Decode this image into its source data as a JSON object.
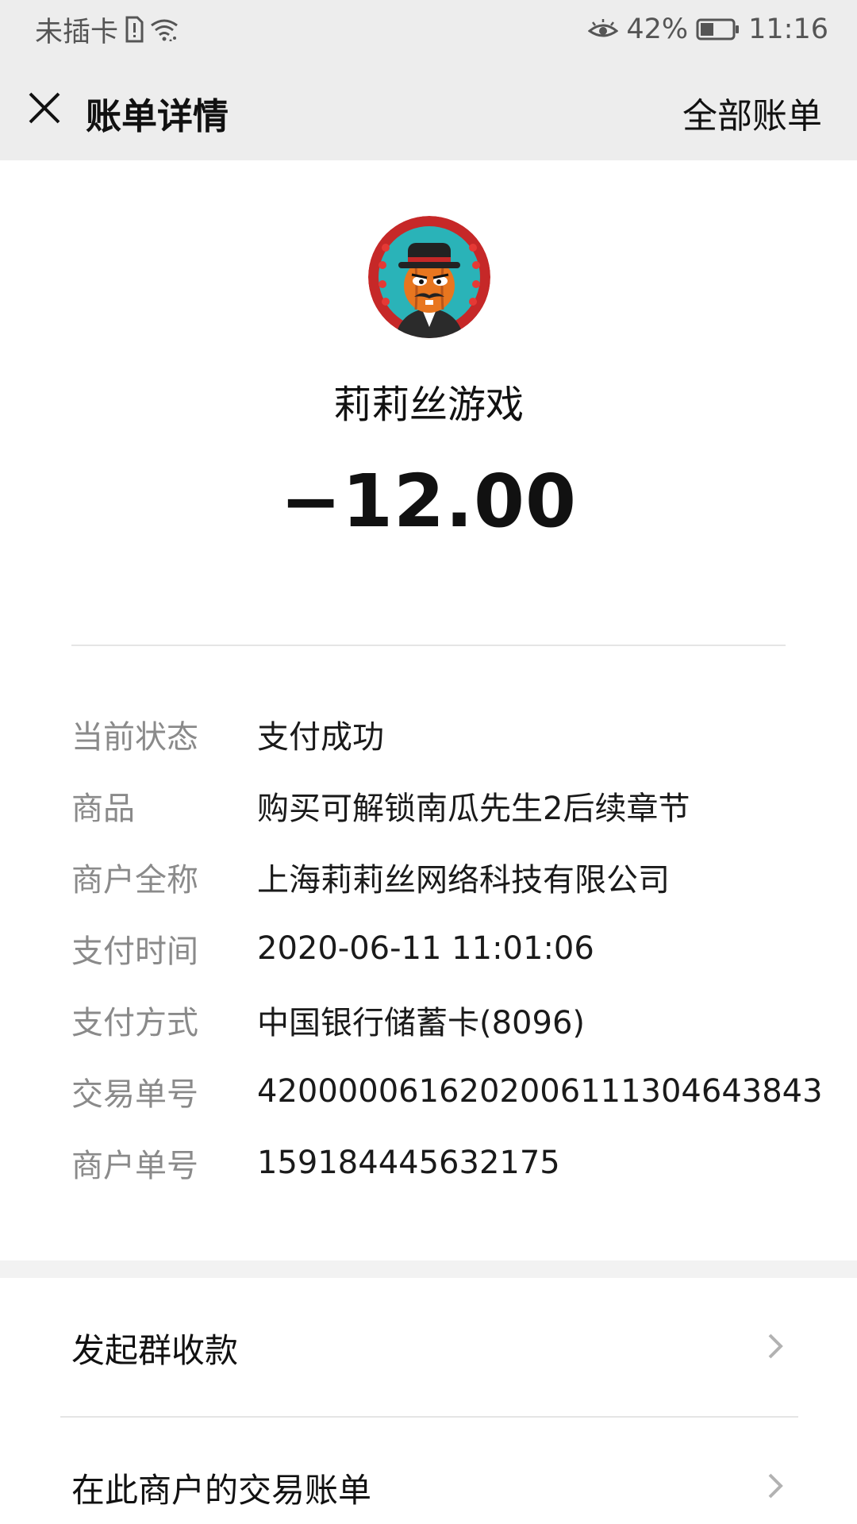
{
  "status_bar": {
    "carrier": "未插卡",
    "battery_percent": "42%",
    "time": "11:16",
    "battery_level": 0.42
  },
  "nav": {
    "title": "账单详情",
    "action": "全部账单",
    "close_icon": "close-icon"
  },
  "merchant": {
    "name": "莉莉丝游戏",
    "amount": "−12.00"
  },
  "details": [
    {
      "label": "当前状态",
      "value": "支付成功"
    },
    {
      "label": "商品",
      "value": "购买可解锁南瓜先生2后续章节"
    },
    {
      "label": "商户全称",
      "value": "上海莉莉丝网络科技有限公司"
    },
    {
      "label": "支付时间",
      "value": "2020-06-11 11:01:06"
    },
    {
      "label": "支付方式",
      "value": "中国银行储蓄卡(8096)"
    },
    {
      "label": "交易单号",
      "value": "4200000616202006111304643843"
    },
    {
      "label": "商户单号",
      "value": "159184445632175"
    }
  ],
  "actions": [
    {
      "label": "发起群收款",
      "icon": "chevron-right-icon"
    },
    {
      "label": "在此商户的交易账单",
      "icon": "chevron-right-icon"
    }
  ],
  "colors": {
    "header_bg": "#ededed",
    "label_gray": "#8a8a8a",
    "text_dark": "#111111"
  }
}
